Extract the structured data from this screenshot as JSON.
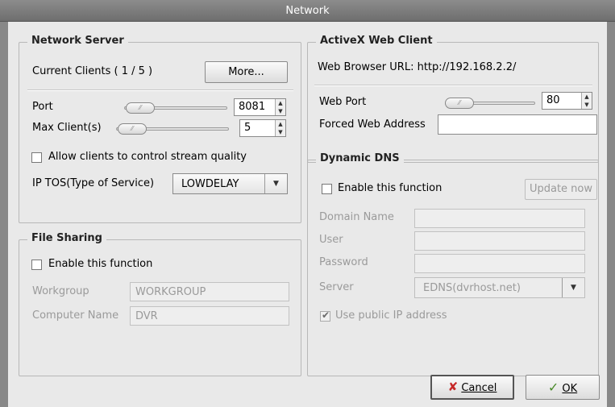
{
  "window": {
    "title": "Network"
  },
  "network_server": {
    "title": "Network Server",
    "current_clients_label": "Current Clients  ( 1 / 5 )",
    "more_button": "More...",
    "port_label": "Port",
    "port_value": "8081",
    "max_clients_label": "Max Client(s)",
    "max_clients_value": "5",
    "allow_quality_label": "Allow clients to control stream quality",
    "allow_quality_checked": false,
    "ip_tos_label": "IP TOS(Type of Service)",
    "ip_tos_value": "LOWDELAY"
  },
  "file_sharing": {
    "title": "File Sharing",
    "enable_label": "Enable this function",
    "enable_checked": false,
    "workgroup_label": "Workgroup",
    "workgroup_value": "WORKGROUP",
    "computer_name_label": "Computer Name",
    "computer_name_value": "DVR"
  },
  "activex": {
    "title": "ActiveX Web Client",
    "url_text": "Web Browser URL: http://192.168.2.2/",
    "web_port_label": "Web Port",
    "web_port_value": "80",
    "forced_address_label": "Forced Web Address",
    "forced_address_value": ""
  },
  "dynamic_dns": {
    "title": "Dynamic DNS",
    "enable_label": "Enable this function",
    "enable_checked": false,
    "update_button": "Update now",
    "domain_label": "Domain Name",
    "user_label": "User",
    "password_label": "Password",
    "server_label": "Server",
    "server_value": "EDNS(dvrhost.net)",
    "public_ip_label": "Use public IP address",
    "public_ip_checked": true
  },
  "footer": {
    "cancel_label": "Cancel",
    "ok_label": "OK"
  }
}
